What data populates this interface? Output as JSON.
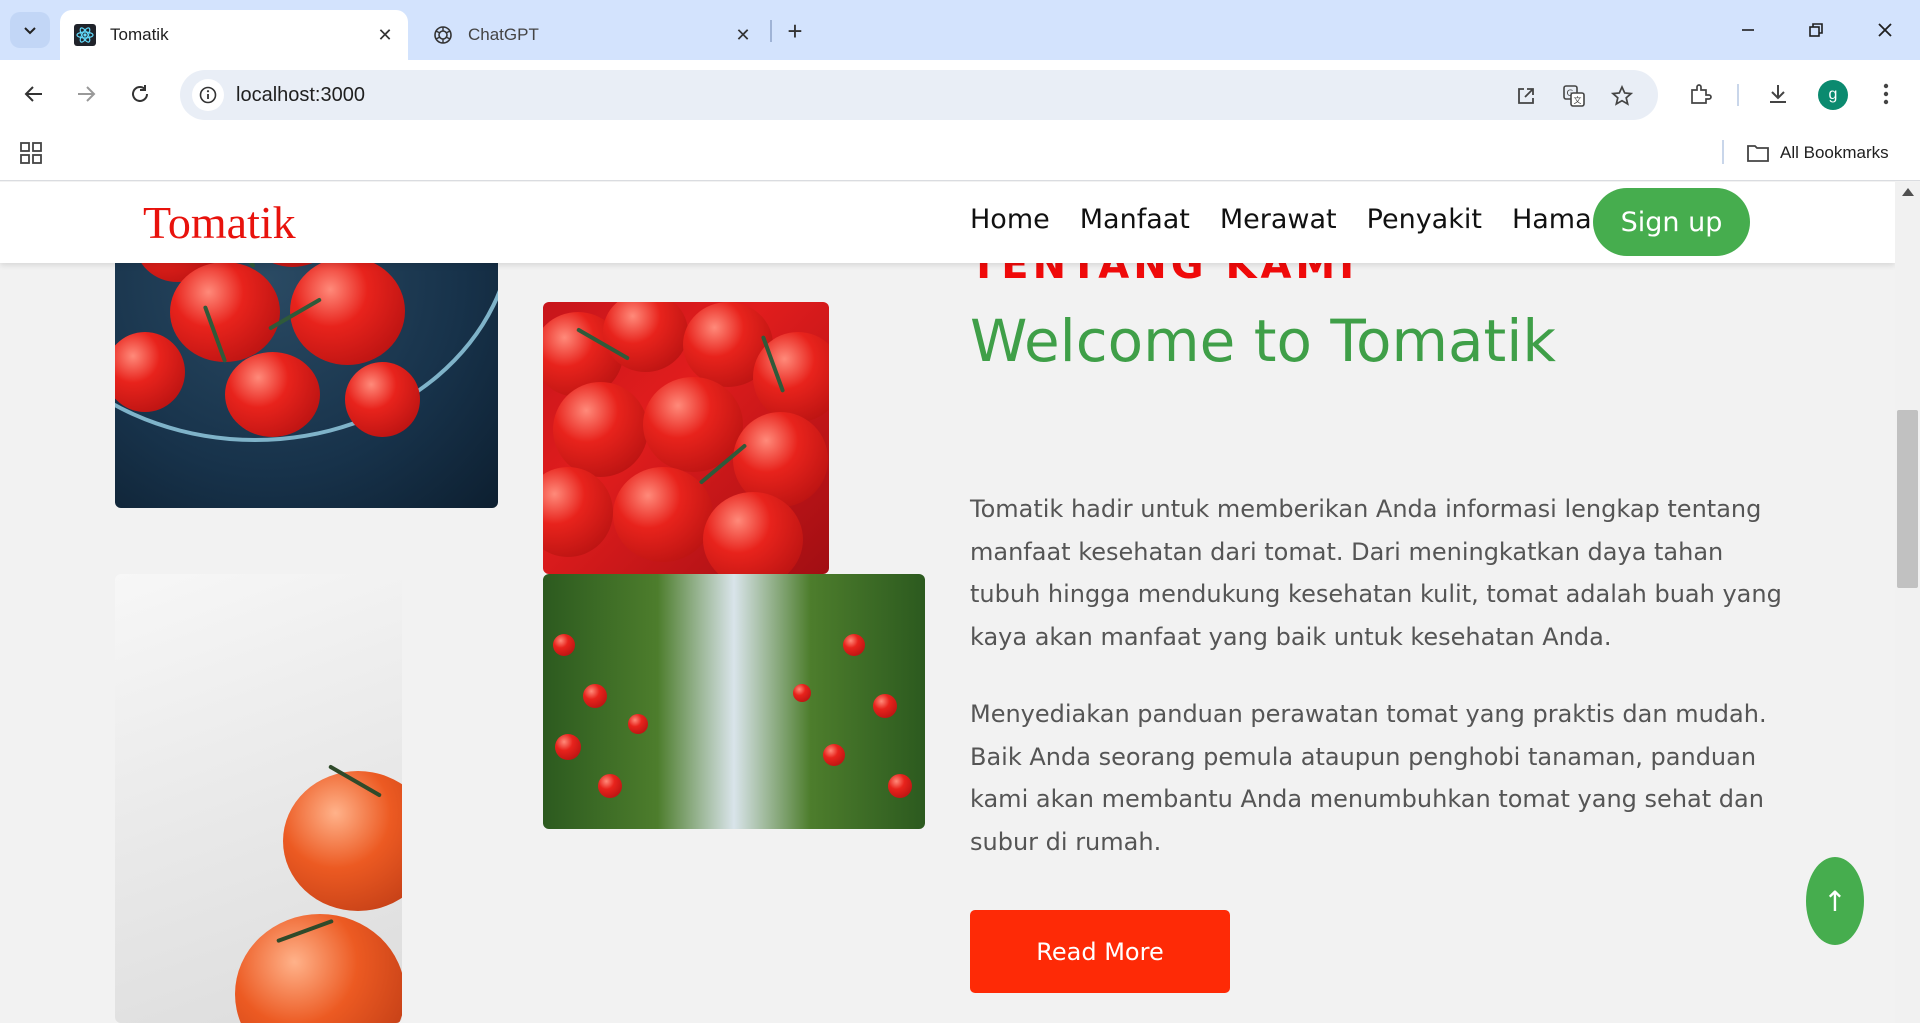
{
  "browser": {
    "tabs": [
      {
        "title": "Tomatik",
        "active": true,
        "icon": "react-icon"
      },
      {
        "title": "ChatGPT",
        "active": false,
        "icon": "openai-icon"
      }
    ],
    "url": "localhost:3000",
    "bookmarks_label": "All Bookmarks",
    "profile_initial": "g"
  },
  "site": {
    "logo": "Tomatik",
    "nav": [
      "Home",
      "Manfaat",
      "Merawat",
      "Penyakit",
      "Hama"
    ],
    "signup_label": "Sign up",
    "accent_red": "#f00a0a",
    "accent_green": "#46ad4e"
  },
  "about": {
    "eyebrow": "TENTANG KAMI",
    "headline": "Welcome to Tomatik",
    "paragraph1": "Tomatik hadir untuk memberikan Anda informasi lengkap tentang manfaat kesehatan dari tomat. Dari meningkatkan daya tahan tubuh hingga mendukung kesehatan kulit, tomat adalah buah yang kaya akan manfaat yang baik untuk kesehatan Anda.",
    "paragraph2": "Menyediakan panduan perawatan tomat yang praktis dan mudah. Baik Anda seorang pemula ataupun penghobi tanaman, panduan kami akan membantu Anda menumbuhkan tomat yang sehat dan subur di rumah.",
    "read_more_label": "Read More",
    "scroll_top_label": "↑"
  }
}
